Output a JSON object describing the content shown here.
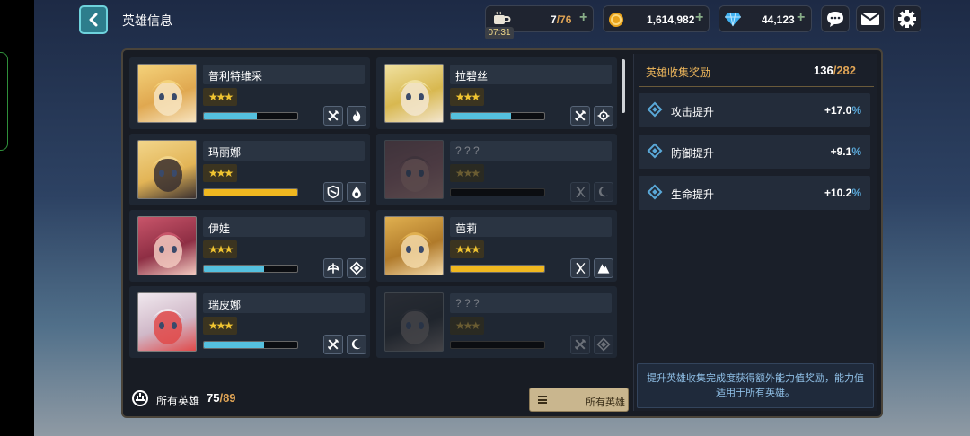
{
  "header": {
    "title": "英雄信息",
    "resources": {
      "stamina": "7",
      "stamina_max": "76",
      "timer": "07:31",
      "gold": "1,614,982",
      "gems": "44,123"
    }
  },
  "heroes": [
    {
      "name": "普利特维采",
      "stars": "★★★",
      "progress": 0.57,
      "bar_color": "blue",
      "roles": [
        "crossed-swords-icon",
        "fire-icon"
      ],
      "locked": false
    },
    {
      "name": "拉碧丝",
      "stars": "★★★",
      "progress": 0.64,
      "bar_color": "blue",
      "roles": [
        "crossed-swords-icon",
        "gear-icon"
      ],
      "locked": false
    },
    {
      "name": "玛丽娜",
      "stars": "★★★",
      "progress": 1.0,
      "bar_color": "gold",
      "roles": [
        "shield-icon",
        "water-drop-icon"
      ],
      "locked": false
    },
    {
      "name": "? ? ?",
      "stars": "★★★",
      "progress": 0,
      "bar_color": "blue",
      "roles": [
        "bow-icon",
        "moon-icon"
      ],
      "locked": true
    },
    {
      "name": "伊娃",
      "stars": "★★★",
      "progress": 0.64,
      "bar_color": "blue",
      "roles": [
        "wing-icon",
        "diamond-icon"
      ],
      "locked": false
    },
    {
      "name": "芭莉",
      "stars": "★★★",
      "progress": 1.0,
      "bar_color": "gold",
      "roles": [
        "bow-icon",
        "mountain-icon"
      ],
      "locked": false
    },
    {
      "name": "瑞皮娜",
      "stars": "★★★",
      "progress": 0.64,
      "bar_color": "blue",
      "roles": [
        "crossed-swords-icon",
        "moon-icon"
      ],
      "locked": false
    },
    {
      "name": "? ? ?",
      "stars": "★★★",
      "progress": 0,
      "bar_color": "blue",
      "roles": [
        "crossed-swords-icon",
        "diamond-icon"
      ],
      "locked": true
    }
  ],
  "footer": {
    "label": "所有英雄",
    "count": "75",
    "max": "/89",
    "filter_label": "所有英雄"
  },
  "rewards": {
    "title": "英雄收集奖励",
    "count": "136",
    "max": "/282",
    "bonuses": [
      {
        "label": "攻击提升",
        "value": "+17.0",
        "unit": "%"
      },
      {
        "label": "防御提升",
        "value": "+9.1",
        "unit": "%"
      },
      {
        "label": "生命提升",
        "value": "+10.2",
        "unit": "%"
      }
    ],
    "note": "提升英雄收集完成度获得额外能力值奖励，能力值适用于所有英雄。"
  }
}
